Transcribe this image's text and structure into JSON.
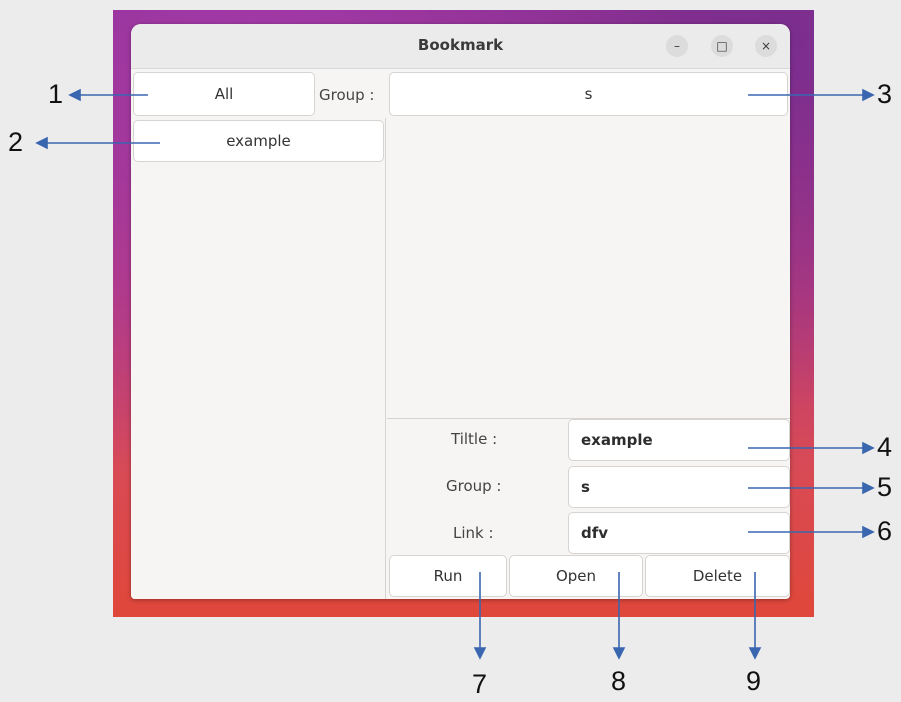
{
  "window": {
    "title": "Bookmark",
    "controls": {
      "minimize": "–",
      "maximize": "□",
      "close": "×"
    }
  },
  "toolbar": {
    "all_button": "All",
    "group_label": "Group :",
    "group_value": "s"
  },
  "list": {
    "items": [
      {
        "label": "example"
      }
    ]
  },
  "form": {
    "title_label": "Tiltle :",
    "title_value": "example",
    "group_label": "Group :",
    "group_value": "s",
    "link_label": "Link :",
    "link_value": "dfv"
  },
  "actions": {
    "run": "Run",
    "open": "Open",
    "delete": "Delete"
  },
  "annotations": [
    "1",
    "2",
    "3",
    "4",
    "5",
    "6",
    "7",
    "8",
    "9"
  ],
  "colors": {
    "arrow": "#3a66b0",
    "window_bg": "#f6f5f4",
    "titlebar_bg": "#ebebeb"
  }
}
